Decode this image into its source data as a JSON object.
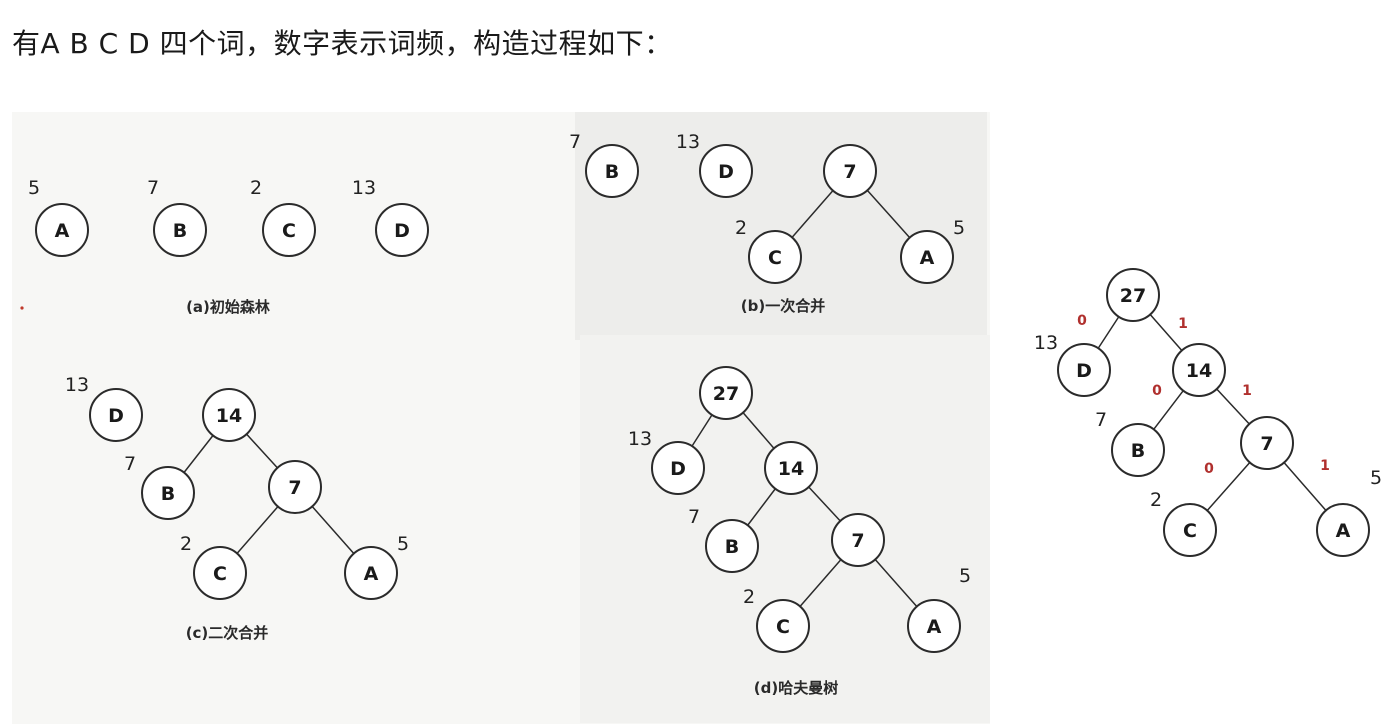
{
  "heading": "有A B C D 四个词，数字表示词频，构造过程如下：",
  "colors": {
    "bit": "#b0302e",
    "stroke": "#2b2b2b",
    "text": "#1a1a1a"
  },
  "panels": [
    {
      "id": "a",
      "caption": "(a)初始森林",
      "nodes": [
        {
          "id": "A",
          "label": "A",
          "weight": "5"
        },
        {
          "id": "B",
          "label": "B",
          "weight": "7"
        },
        {
          "id": "C",
          "label": "C",
          "weight": "2"
        },
        {
          "id": "D",
          "label": "D",
          "weight": "13"
        }
      ],
      "edges": []
    },
    {
      "id": "b",
      "caption": "(b)一次合并",
      "nodes": [
        {
          "id": "B",
          "label": "B",
          "weight": "7"
        },
        {
          "id": "D",
          "label": "D",
          "weight": "13"
        },
        {
          "id": "n7",
          "label": "7",
          "weight": ""
        },
        {
          "id": "C",
          "label": "C",
          "weight": "2"
        },
        {
          "id": "A",
          "label": "A",
          "weight": "5"
        }
      ],
      "edges": [
        {
          "from": "n7",
          "to": "C"
        },
        {
          "from": "n7",
          "to": "A"
        }
      ]
    },
    {
      "id": "c",
      "caption": "(c)二次合并",
      "nodes": [
        {
          "id": "D",
          "label": "D",
          "weight": "13"
        },
        {
          "id": "n14",
          "label": "14",
          "weight": ""
        },
        {
          "id": "B",
          "label": "B",
          "weight": "7"
        },
        {
          "id": "n7",
          "label": "7",
          "weight": ""
        },
        {
          "id": "C",
          "label": "C",
          "weight": "2"
        },
        {
          "id": "A",
          "label": "A",
          "weight": "5"
        }
      ],
      "edges": [
        {
          "from": "n14",
          "to": "B"
        },
        {
          "from": "n14",
          "to": "n7"
        },
        {
          "from": "n7",
          "to": "C"
        },
        {
          "from": "n7",
          "to": "A"
        }
      ]
    },
    {
      "id": "d",
      "caption": "(d)哈夫曼树",
      "nodes": [
        {
          "id": "n27",
          "label": "27",
          "weight": ""
        },
        {
          "id": "D",
          "label": "D",
          "weight": "13"
        },
        {
          "id": "n14",
          "label": "14",
          "weight": ""
        },
        {
          "id": "B",
          "label": "B",
          "weight": "7"
        },
        {
          "id": "n7",
          "label": "7",
          "weight": ""
        },
        {
          "id": "C",
          "label": "C",
          "weight": "2"
        },
        {
          "id": "A",
          "label": "A",
          "weight": "5"
        }
      ],
      "edges": [
        {
          "from": "n27",
          "to": "D"
        },
        {
          "from": "n27",
          "to": "n14"
        },
        {
          "from": "n14",
          "to": "B"
        },
        {
          "from": "n14",
          "to": "n7"
        },
        {
          "from": "n7",
          "to": "C"
        },
        {
          "from": "n7",
          "to": "A"
        }
      ]
    },
    {
      "id": "e",
      "caption": "",
      "nodes": [
        {
          "id": "n27",
          "label": "27",
          "weight": ""
        },
        {
          "id": "D",
          "label": "D",
          "weight": "13"
        },
        {
          "id": "n14",
          "label": "14",
          "weight": ""
        },
        {
          "id": "B",
          "label": "B",
          "weight": "7"
        },
        {
          "id": "n7",
          "label": "7",
          "weight": ""
        },
        {
          "id": "C",
          "label": "C",
          "weight": "2"
        },
        {
          "id": "A",
          "label": "A",
          "weight": "5"
        }
      ],
      "edges": [
        {
          "from": "n27",
          "to": "D",
          "bit": "0"
        },
        {
          "from": "n27",
          "to": "n14",
          "bit": "1"
        },
        {
          "from": "n14",
          "to": "B",
          "bit": "0"
        },
        {
          "from": "n14",
          "to": "n7",
          "bit": "1"
        },
        {
          "from": "n7",
          "to": "C",
          "bit": "0"
        },
        {
          "from": "n7",
          "to": "A",
          "bit": "1"
        }
      ]
    }
  ]
}
